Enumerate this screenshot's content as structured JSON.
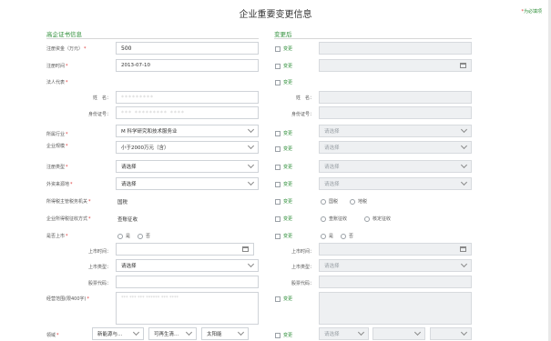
{
  "page": {
    "title": "企业重要变更信息",
    "required_note": "为必填项",
    "required_mark": "*"
  },
  "sections": {
    "left": "高企证书信息",
    "right": "变更后"
  },
  "common": {
    "change_label": "变更",
    "select_placeholder": "请选择"
  },
  "fields": {
    "registered_capital": {
      "label": "注册资金（万元）",
      "value": "500"
    },
    "registration_time": {
      "label": "注册时间",
      "value": "2013-07-10"
    },
    "legal_rep": {
      "label": "法人代表"
    },
    "name": {
      "label": "姓　名：",
      "value": "*********"
    },
    "id_number": {
      "label": "身份证号：",
      "value": "*** ********* ****"
    },
    "right_name": {
      "label": "姓　名："
    },
    "right_id_number": {
      "label": "身份证号："
    },
    "industry": {
      "label": "所属行业",
      "value": "M 科学研究和技术服务业"
    },
    "scale": {
      "label": "企业规模",
      "value": "小于2000万元（含）"
    },
    "reg_type": {
      "label": "注册类型",
      "value": "请选择"
    },
    "foreign_source": {
      "label": "外资来源地",
      "value": "请选择"
    },
    "tax_authority": {
      "label": "所得税主管税务机关",
      "value": "国税",
      "options": [
        "国税",
        "地税"
      ]
    },
    "tax_method": {
      "label": "企业所得税征收方式",
      "value": "查账征收",
      "options": [
        "查账征收",
        "核定征收"
      ]
    },
    "listed": {
      "label": "是否上市",
      "options": [
        "是",
        "否"
      ]
    },
    "listing_time": {
      "label": "上市时间："
    },
    "listing_type": {
      "label": "上市类型：",
      "value": "请选择"
    },
    "stock_code": {
      "label": "股票代码："
    },
    "business_scope": {
      "label": "经营范围(限400字)",
      "value": "*** *** *** ****** *** ****"
    },
    "region": {
      "label": "领域",
      "value1": "新能源与...",
      "value2": "可再生清...",
      "value3": "太阳能"
    }
  }
}
